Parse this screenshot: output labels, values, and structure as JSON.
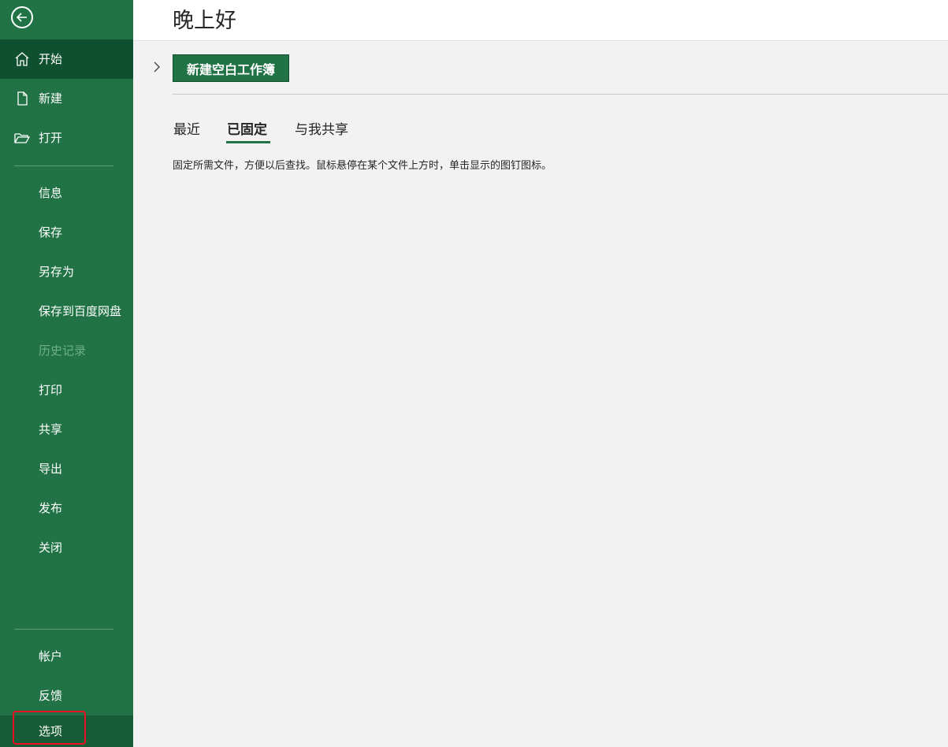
{
  "sidebar": {
    "items": [
      {
        "label": "开始"
      },
      {
        "label": "新建"
      },
      {
        "label": "打开"
      },
      {
        "label": "信息"
      },
      {
        "label": "保存"
      },
      {
        "label": "另存为"
      },
      {
        "label": "保存到百度网盘"
      },
      {
        "label": "历史记录"
      },
      {
        "label": "打印"
      },
      {
        "label": "共享"
      },
      {
        "label": "导出"
      },
      {
        "label": "发布"
      },
      {
        "label": "关闭"
      },
      {
        "label": "帐户"
      },
      {
        "label": "反馈"
      },
      {
        "label": "选项"
      }
    ]
  },
  "header": {
    "greeting": "晚上好"
  },
  "main": {
    "new_blank_label": "新建空白工作簿",
    "tabs": [
      {
        "label": "最近"
      },
      {
        "label": "已固定"
      },
      {
        "label": "与我共享"
      }
    ],
    "pinned_hint": "固定所需文件，方便以后查找。鼠标悬停在某个文件上方时，单击显示的图钉图标。"
  },
  "colors": {
    "sidebar_bg": "#217346",
    "active_item_bg": "#0f5030",
    "highlight_border": "#e81123"
  }
}
